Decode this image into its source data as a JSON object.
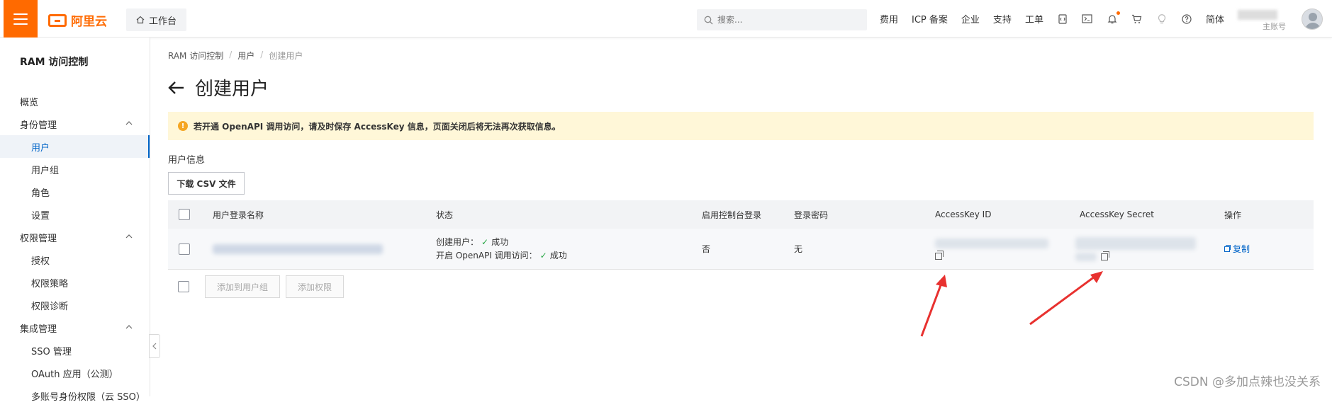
{
  "topbar": {
    "logo_text": "阿里云",
    "workbench_label": "工作台",
    "search_placeholder": "搜索...",
    "nav_items": [
      "费用",
      "ICP 备案",
      "企业",
      "支持",
      "工单"
    ],
    "language": "简体",
    "account_role": "主账号",
    "accent_color": "#ff6a00"
  },
  "sidebar": {
    "title": "RAM 访问控制",
    "items": [
      {
        "label": "概览"
      },
      {
        "label": "身份管理"
      },
      {
        "label": "用户"
      },
      {
        "label": "用户组"
      },
      {
        "label": "角色"
      },
      {
        "label": "设置"
      },
      {
        "label": "权限管理"
      },
      {
        "label": "授权"
      },
      {
        "label": "权限策略"
      },
      {
        "label": "权限诊断"
      },
      {
        "label": "集成管理"
      },
      {
        "label": "SSO 管理"
      },
      {
        "label": "OAuth 应用（公测）"
      },
      {
        "label": "多账号身份权限（云 SSO）"
      }
    ]
  },
  "breadcrumb": [
    "RAM 访问控制",
    "用户",
    "创建用户"
  ],
  "page": {
    "title": "创建用户",
    "alert": "若开通 OpenAPI 调用访问，请及时保存 AccessKey 信息，页面关闭后将无法再次获取信息。",
    "section_title": "用户信息",
    "download_csv": "下载 CSV 文件"
  },
  "table": {
    "headers": [
      "用户登录名称",
      "状态",
      "启用控制台登录",
      "登录密码",
      "AccessKey ID",
      "AccessKey Secret",
      "操作"
    ],
    "row": {
      "status_create_label": "创建用户：",
      "status_create_value": "成功",
      "status_api_label": "开启 OpenAPI 调用访问：",
      "status_api_value": "成功",
      "console_login": "否",
      "password": "无",
      "action": "复制"
    }
  },
  "bottom_actions": {
    "add_to_group": "添加到用户组",
    "add_permission": "添加权限"
  },
  "watermark": "CSDN @多加点辣也没关系"
}
